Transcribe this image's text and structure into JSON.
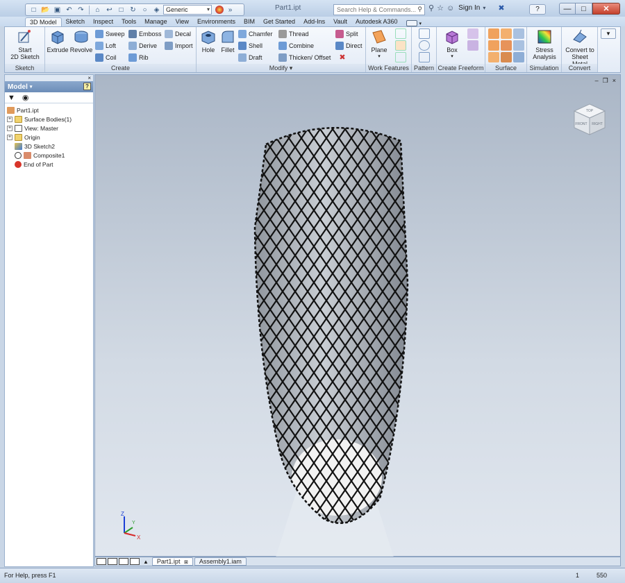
{
  "titlebar": {
    "document_title": "Part1.ipt",
    "appearance_value": "Generic",
    "search_placeholder": "Search Help & Commands...",
    "sign_in": "Sign In",
    "help": "?"
  },
  "tabs": [
    {
      "label": "3D Model"
    },
    {
      "label": "Sketch"
    },
    {
      "label": "Inspect"
    },
    {
      "label": "Tools"
    },
    {
      "label": "Manage"
    },
    {
      "label": "View"
    },
    {
      "label": "Environments"
    },
    {
      "label": "BIM"
    },
    {
      "label": "Get Started"
    },
    {
      "label": "Add-Ins"
    },
    {
      "label": "Vault"
    },
    {
      "label": "Autodesk A360"
    }
  ],
  "ribbon": {
    "sketch": {
      "label": "Sketch",
      "start_line1": "Start",
      "start_line2": "2D Sketch"
    },
    "create": {
      "label": "Create",
      "extrude": "Extrude",
      "revolve": "Revolve",
      "sweep": "Sweep",
      "loft": "Loft",
      "coil": "Coil",
      "emboss": "Emboss",
      "derive": "Derive",
      "rib": "Rib",
      "decal": "Decal",
      "import": "Import"
    },
    "modify": {
      "label": "Modify",
      "hole": "Hole",
      "fillet": "Fillet",
      "chamfer": "Chamfer",
      "shell": "Shell",
      "draft": "Draft",
      "thread": "Thread",
      "combine": "Combine",
      "thicken": "Thicken/ Offset",
      "split": "Split",
      "direct": "Direct"
    },
    "work_features": {
      "label": "Work Features",
      "plane": "Plane"
    },
    "pattern": {
      "label": "Pattern"
    },
    "create_freeform": {
      "label": "Create Freeform",
      "box": "Box"
    },
    "surface": {
      "label": "Surface"
    },
    "simulation": {
      "label": "Simulation",
      "stress_line1": "Stress",
      "stress_line2": "Analysis"
    },
    "convert": {
      "label": "Convert",
      "sheet_line1": "Convert to",
      "sheet_line2": "Sheet Metal"
    }
  },
  "browser": {
    "header": "Model",
    "tree": [
      {
        "label": "Part1.ipt"
      },
      {
        "label": "Surface Bodies(1)"
      },
      {
        "label": "View: Master"
      },
      {
        "label": "Origin"
      },
      {
        "label": "3D Sketch2"
      },
      {
        "label": "Composite1"
      },
      {
        "label": "End of Part"
      }
    ]
  },
  "viewcube": {
    "top": "TOP",
    "front": "FRONT",
    "right": "RIGHT"
  },
  "triad": {
    "z": "Z",
    "y": "Y",
    "x": "X"
  },
  "doc_tabs": [
    {
      "label": "Part1.ipt"
    },
    {
      "label": "Assembly1.iam"
    }
  ],
  "status": {
    "help_text": "For Help, press F1",
    "count1": "1",
    "count2": "550"
  }
}
